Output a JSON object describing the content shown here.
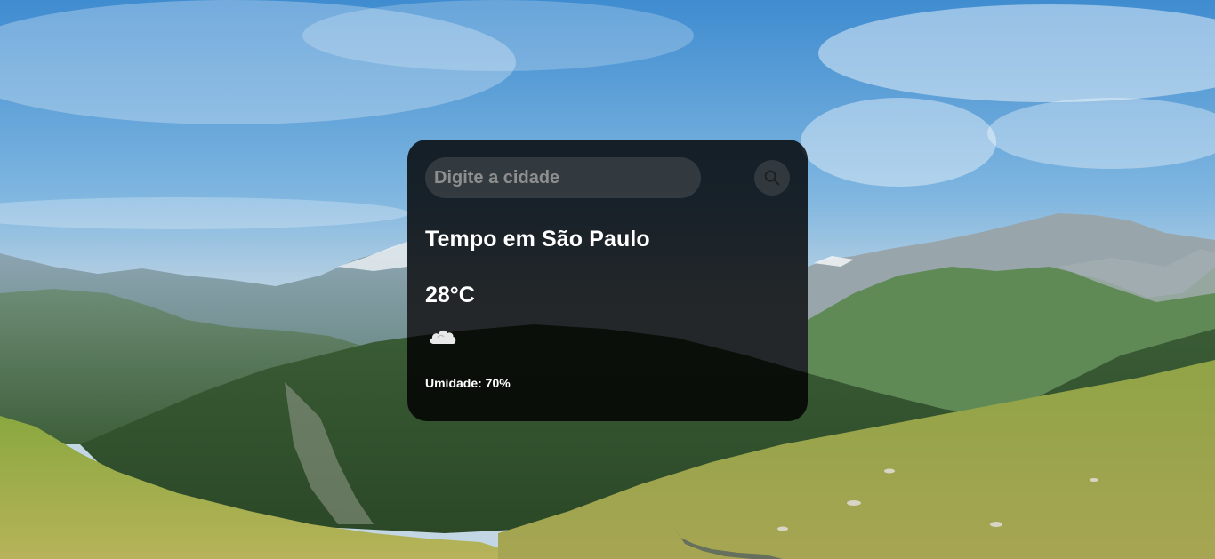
{
  "search": {
    "placeholder": "Digite a cidade",
    "button_icon": "search-icon"
  },
  "weather": {
    "title": "Tempo em São Paulo",
    "temperature": "28°C",
    "condition_icon": "cloud-icon",
    "humidity": "Umidade: 70%"
  },
  "background": {
    "subject": "mountain-landscape"
  }
}
